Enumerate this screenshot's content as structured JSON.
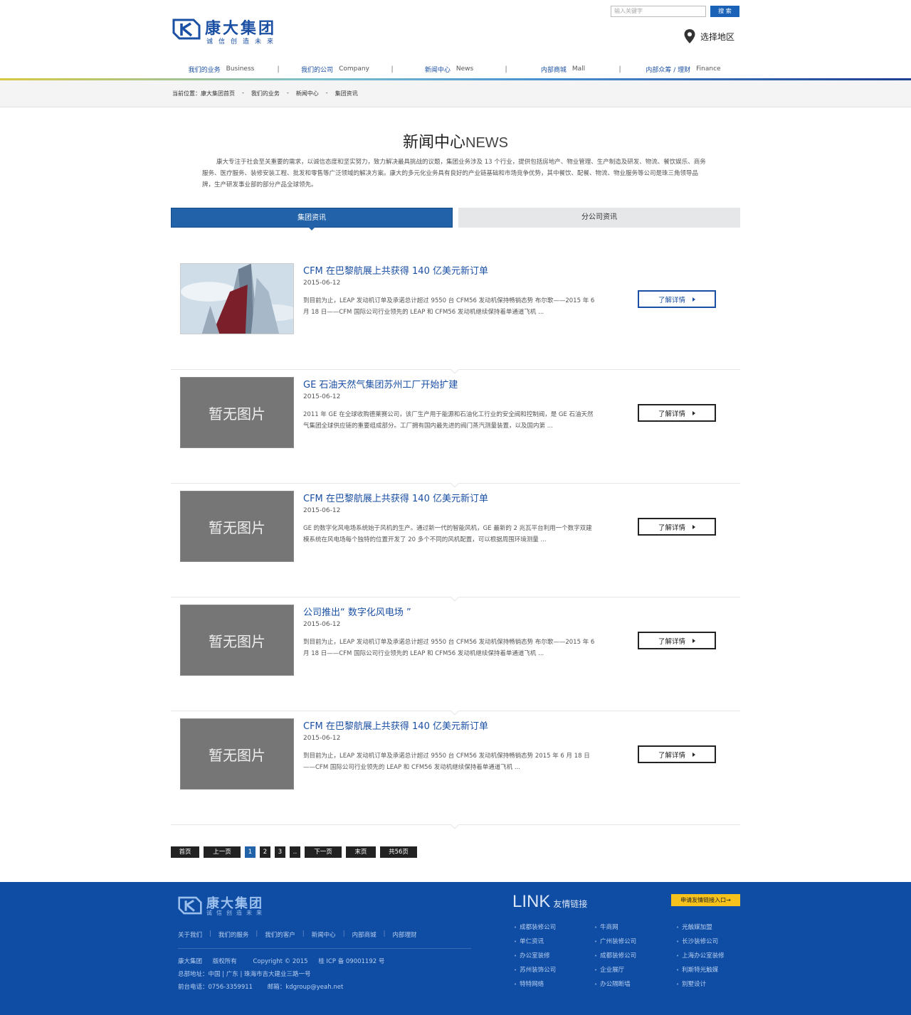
{
  "header": {
    "logo_name": "康大集团",
    "logo_slogan": "诚信创造未来",
    "search_placeholder": "输入关键字",
    "search_button": "搜 索",
    "region_label": "选择地区"
  },
  "nav": [
    {
      "cn": "我们的业务",
      "en": "Business"
    },
    {
      "cn": "我们的公司",
      "en": "Company"
    },
    {
      "cn": "新闻中心",
      "en": "News"
    },
    {
      "cn": "内部商城",
      "en": "Mall"
    },
    {
      "cn": "内部众筹 / 理财",
      "en": "Finance"
    }
  ],
  "nav_separator": "|",
  "breadcrumb": {
    "prefix": "当前位置：康大集团首页",
    "sep": "-",
    "items": [
      "我们的业务",
      "新闻中心",
      "集团资讯"
    ]
  },
  "section": {
    "title_cn": "新闻中心",
    "title_en": "NEWS",
    "intro": "康大专注于社会至关重要的需求，以诚信态度和坚实努力，致力解决最具挑战的议题，集团业务涉及 13 个行业，提供包括房地产、物业管理、生产制造及研发、物流、餐饮娱乐、商务服务、医疗服务、装修安装工程、批发和零售等广泛领域的解决方案。康大的多元化业务具有良好的产业链基础和市场竞争优势，其中餐饮、配餐、物流、物业服务等公司是珠三角领导品牌，生产研发事业部的部分产品全球领先。"
  },
  "tabs": {
    "active": "集团资讯",
    "other": "分公司资讯"
  },
  "news": [
    {
      "title": "CFM 在巴黎航展上共获得 140 亿美元新订单",
      "date": "2015-06-12",
      "desc": "到目前为止，LEAP 发动机订单及承诺总计超过 9550 台 CFM56 发动机保持畅销态势 布尔歌——2015 年 6 月 18 日——CFM 国际公司行业领先的 LEAP 和 CFM56 发动机继续保持着单通道飞机 ...",
      "button": "了解详情",
      "placeholder": ""
    },
    {
      "title": "GE 石油天然气集团苏州工厂开始扩建",
      "date": "2015-06-12",
      "desc": "2011 年 GE 在全球收购德莱赛公司，该厂生产用于能源和石油化工行业的安全阀和控制阀，是 GE 石油天然气集团全球供应链的重要组成部分。工厂拥有国内最先进的阀门蒸汽测量装置，以及国内第 ...",
      "button": "了解详情",
      "placeholder": "暂无图片"
    },
    {
      "title": "CFM 在巴黎航展上共获得 140 亿美元新订单",
      "date": "2015-06-12",
      "desc": "GE 的数字化风电场系统始于风机的生产。通过新一代的智能风机，GE 最新的 2 兆瓦平台利用一个数字双建模系统在风电场每个独特的位置开发了 20 多个不同的风机配置，可以根据周围环境测量 ...",
      "button": "了解详情",
      "placeholder": "暂无图片"
    },
    {
      "title": "公司推出“ 数字化风电场 ”",
      "date": "2015-06-12",
      "desc": "到目前为止，LEAP 发动机订单及承诺总计超过 9550 台 CFM56 发动机保持畅销态势 布尔歌——2015 年 6 月 18 日——CFM 国际公司行业领先的 LEAP 和 CFM56 发动机继续保持着单通道飞机 ...",
      "button": "了解详情",
      "placeholder": "暂无图片"
    },
    {
      "title": "CFM 在巴黎航展上共获得 140 亿美元新订单",
      "date": "2015-06-12",
      "desc": "到目前为止，LEAP 发动机订单及承诺总计超过 9550 台 CFM56 发动机保持畅销态势 2015 年 6 月 18 日——CFM 国际公司行业领先的 LEAP 和 CFM56 发动机继续保持着单通道飞机 ...",
      "button": "了解详情",
      "placeholder": "暂无图片"
    }
  ],
  "pager": {
    "first": "首页",
    "prev": "上一页",
    "pages": [
      "1",
      "2",
      "3"
    ],
    "current": "1",
    "ellipsis": "..",
    "next": "下一页",
    "last": "末页",
    "total": "共56页"
  },
  "footer": {
    "logo_name": "康大集团",
    "logo_slogan": "诚信创造未来",
    "links": [
      "关于我们",
      "我们的服务",
      "我们的客户",
      "新闻中心",
      "内部商城",
      "内部理财"
    ],
    "link_sep": "|",
    "copy_company": "康大集团",
    "copy_rights": "版权所有",
    "copyright": "Copyright © 2015",
    "icp": "桂 ICP 备 09001192 号",
    "address": "总部地址：中国 | 广东 | 珠海市吉大建业三路一号",
    "phone": "前台电话：0756-3359911",
    "email": "邮箱：kdgroup@yeah.net",
    "link_title_en": "LINK",
    "link_title_cn": "友情链接",
    "apply_button": "申请友情链接入口→",
    "friend_links": [
      [
        "成都装修公司",
        "单仁资讯",
        "办公室装修",
        "苏州装饰公司",
        "特特网络"
      ],
      [
        "牛商网",
        "广州装修公司",
        "成都装修公司",
        "企业展厅",
        "办公隔断墙"
      ],
      [
        "光触媒加盟",
        "长沙装修公司",
        "上海办公室装修",
        "利斯特光触媒",
        "别墅设计"
      ]
    ]
  },
  "colors": {
    "brand_blue": "#1a4fa3",
    "tab_blue": "#2162a8",
    "footer_blue": "#0f4ca3",
    "apply_yellow": "#f6c21b"
  }
}
